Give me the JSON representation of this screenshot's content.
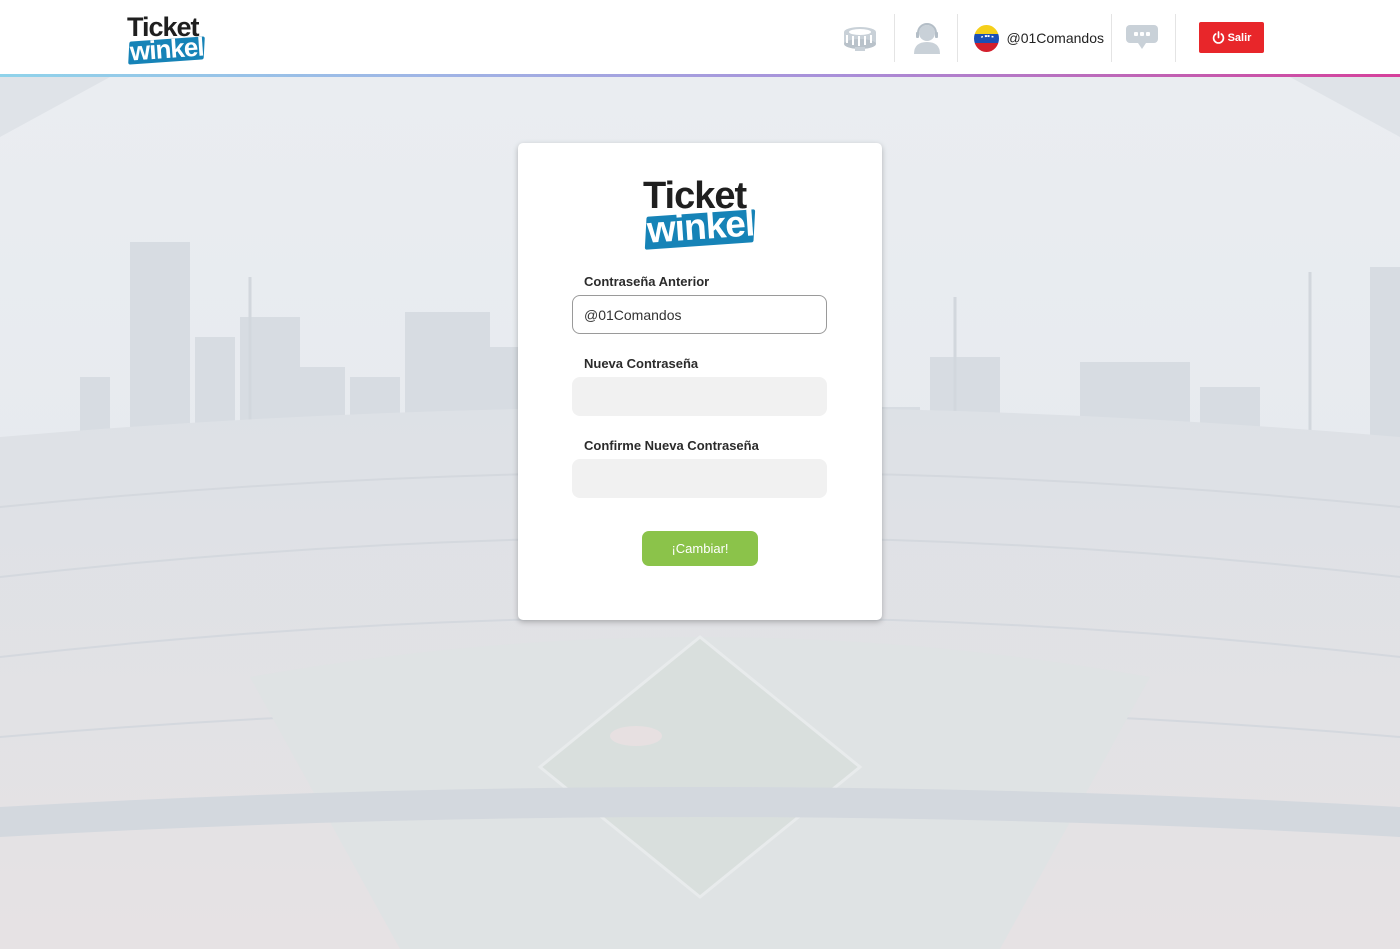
{
  "header": {
    "logo": {
      "line1": "Ticket",
      "line2": "winkel"
    },
    "icons": {
      "stadium": "stadium-icon",
      "support": "support-agent-icon",
      "chat": "chat-bubble-icon",
      "power": "power-icon"
    },
    "user": {
      "flag": "venezuela-flag-icon",
      "username": "@01Comandos"
    },
    "logout_label": "Salir"
  },
  "form": {
    "logo": {
      "line1": "Ticket",
      "line2": "winkel"
    },
    "fields": [
      {
        "label": "Contraseña Anterior",
        "value": "@01Comandos",
        "placeholder": ""
      },
      {
        "label": "Nueva Contraseña",
        "value": "",
        "placeholder": ""
      },
      {
        "label": "Confirme Nueva Contraseña",
        "value": "",
        "placeholder": ""
      }
    ],
    "submit_label": "¡Cambiar!"
  },
  "colors": {
    "brand_blue": "#1683b7",
    "logout_red": "#e8262a",
    "submit_green": "#8bc34a"
  }
}
